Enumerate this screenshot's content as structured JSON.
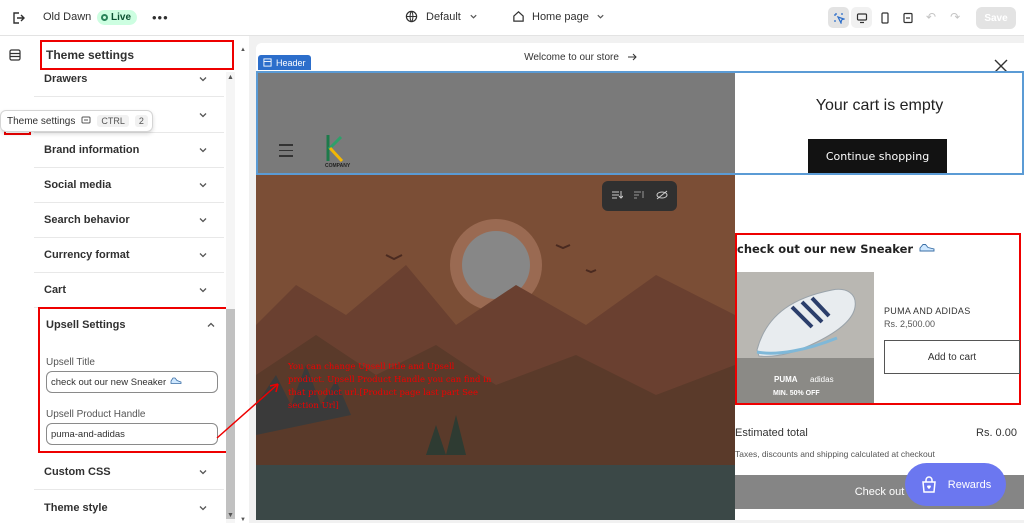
{
  "topbar": {
    "store_name": "Old Dawn",
    "live_label": "Live",
    "theme_name": "Default",
    "page_name": "Home page",
    "save_label": "Save"
  },
  "tooltip": {
    "label": "Theme settings",
    "kbd_key": "CTRL",
    "kbd_num": "2"
  },
  "panel": {
    "title": "Theme settings",
    "items": [
      {
        "label": "Drawers"
      },
      {
        "label": ""
      },
      {
        "label": "Brand information"
      },
      {
        "label": "Social media"
      },
      {
        "label": "Search behavior"
      },
      {
        "label": "Currency format"
      },
      {
        "label": "Cart"
      }
    ],
    "upsell": {
      "heading": "Upsell Settings",
      "title_label": "Upsell Title",
      "title_value": "check out our new Sneaker",
      "handle_label": "Upsell Product Handle",
      "handle_value": "puma-and-adidas"
    },
    "after_items": [
      {
        "label": "Custom CSS"
      },
      {
        "label": "Theme style"
      }
    ]
  },
  "preview": {
    "announcement": "Welcome to our store",
    "header_tag": "Header",
    "logo_text": "COMPANY",
    "note": "You can change Upsell title and Upsell product. Upsell Product Handle you can find in that product url.[Product page last part See section Url]"
  },
  "cart": {
    "empty_text": "Your cart is empty",
    "continue_label": "Continue shopping",
    "upsell_title": "check out our new Sneaker",
    "product_brand": "PUMA AND ADIDAS",
    "product_price": "Rs. 2,500.00",
    "product_img_brand1": "PUMA",
    "product_img_brand2": "adidas",
    "product_img_offer": "MIN. 50% OFF",
    "add_to_cart": "Add to cart",
    "estimated_label": "Estimated total",
    "estimated_value": "Rs. 0.00",
    "taxes_note": "Taxes, discounts and shipping calculated at checkout",
    "checkout_label": "Check out"
  },
  "rewards_label": "Rewards",
  "colors": {
    "accent_red": "#e00000",
    "header_blue": "#2c6ecb",
    "live_green": "#cdfee1",
    "rewards_purple": "#6b77f0"
  }
}
